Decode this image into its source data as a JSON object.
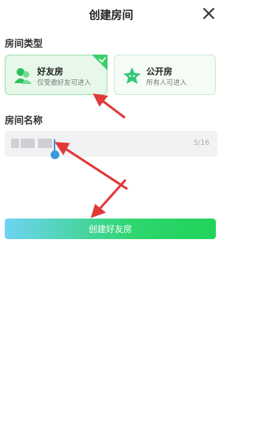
{
  "header": {
    "title": "创建房间",
    "close_icon": "close-icon"
  },
  "room_type": {
    "label": "房间类型",
    "options": [
      {
        "name": "好友房",
        "desc": "仅受邀好友可进入",
        "selected": true,
        "icon": "friends-icon"
      },
      {
        "name": "公开房",
        "desc": "所有人可进入",
        "selected": false,
        "icon": "public-star-icon"
      }
    ]
  },
  "room_name": {
    "label": "房间名称",
    "count": "5/16"
  },
  "actions": {
    "create_label": "创建好友房"
  },
  "colors": {
    "accent_green": "#21d35a",
    "accent_blue": "#6fd3f3",
    "arrow_red": "#e03a3a"
  }
}
